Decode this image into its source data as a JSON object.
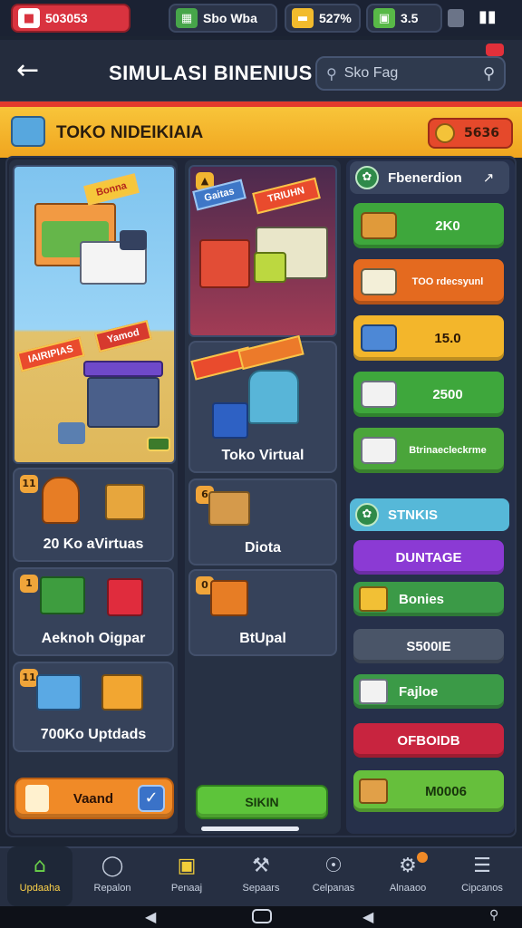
{
  "status": {
    "money": "503053",
    "res1_label": "Sbo Wba",
    "res2_label": "527%",
    "res3_label": "3.5"
  },
  "header": {
    "title": "SIMULASI BINENIUS",
    "search_placeholder": "Sko Fag"
  },
  "shop": {
    "name": "TOKO NIDEIKIAIA",
    "coins": "5636"
  },
  "left_cards": [
    {
      "label": "20 Ko aVirtuas"
    },
    {
      "label": "Aeknoh Oigpar"
    },
    {
      "label": "700Ko Uptdads"
    }
  ],
  "left_button": {
    "label": "Vaand"
  },
  "hero_b_signs": {
    "top": "Gaitas",
    "bottom": "TRIUHN"
  },
  "hero_a_signs": {
    "top": "Bonna",
    "mid": "IAIRIPIAS",
    "bottom": "Yamod"
  },
  "mid_cards": [
    {
      "label": "Toko Virtual"
    },
    {
      "label": "Diota"
    },
    {
      "label": "BtUpal"
    }
  ],
  "mid_button": {
    "label": "SIKIN"
  },
  "right_header": {
    "label": "Fbenerdion"
  },
  "right_items": [
    {
      "label": "2K0",
      "color": "#3ea73c"
    },
    {
      "label": "TOO rdecsyunl",
      "color": "#e46a1f"
    },
    {
      "label": "15.0",
      "color": "#f3b62b"
    },
    {
      "label": "2500",
      "color": "#3ea73c"
    },
    {
      "label": "Btrinaecleckrme",
      "color": "#4aa53a"
    }
  ],
  "stats_header": {
    "label": "STNKIS"
  },
  "stats_items": [
    {
      "label": "DUNTAGE",
      "color": "#8b3ad4"
    },
    {
      "label": "Bonies",
      "color": "#3b9a47"
    },
    {
      "label": "S500IE",
      "color": "#4a5568"
    },
    {
      "label": "Fajloe",
      "color": "#3b9a47"
    },
    {
      "label": "OFBOIDB",
      "color": "#c8243f"
    },
    {
      "label": "M0006",
      "color": "#66bf3c"
    }
  ],
  "nav": [
    {
      "label": "Updaaha",
      "icon": "home-icon"
    },
    {
      "label": "Repalon",
      "icon": "person-icon"
    },
    {
      "label": "Penaaj",
      "icon": "cart-icon"
    },
    {
      "label": "Sepaars",
      "icon": "tools-icon"
    },
    {
      "label": "Celpanas",
      "icon": "gauge-icon"
    },
    {
      "label": "Alnaaoo",
      "icon": "gear-icon"
    },
    {
      "label": "Cipcanos",
      "icon": "menu-icon"
    }
  ]
}
